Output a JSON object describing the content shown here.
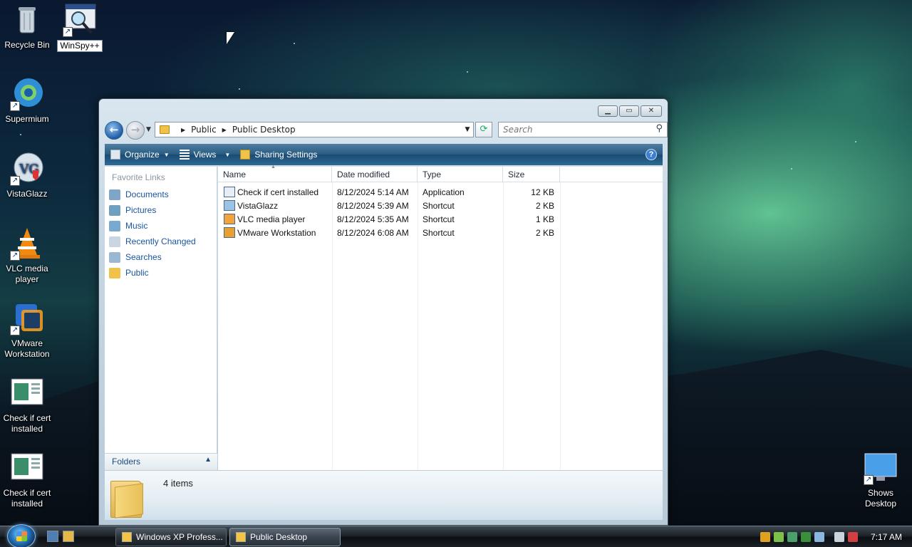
{
  "desktop": {
    "icons": [
      {
        "label": "Recycle Bin",
        "icon": "recycle-bin-icon"
      },
      {
        "label": "WinSpy++",
        "icon": "winspy-icon"
      },
      {
        "label": "Supermium",
        "icon": "supermium-icon"
      },
      {
        "label": "VistaGlazz",
        "icon": "vistaglazz-icon"
      },
      {
        "label": "VLC media player",
        "icon": "vlc-cone-icon"
      },
      {
        "label": "VMware Workstation",
        "icon": "vmware-icon"
      },
      {
        "label": "Check if cert installed",
        "icon": "app-window-icon"
      },
      {
        "label": "Check if cert installed",
        "icon": "app-window-icon"
      },
      {
        "label": "Shows Desktop",
        "icon": "show-desktop-icon"
      }
    ]
  },
  "window": {
    "address": {
      "segments": [
        "Public",
        "Public Desktop"
      ]
    },
    "search": {
      "placeholder": "Search"
    },
    "toolbar": {
      "organize": "Organize",
      "views": "Views",
      "sharing": "Sharing Settings"
    },
    "navpane": {
      "heading": "Favorite Links",
      "links": [
        "Documents",
        "Pictures",
        "Music",
        "Recently Changed",
        "Searches",
        "Public"
      ],
      "folders": "Folders"
    },
    "columns": {
      "name": "Name",
      "date": "Date modified",
      "type": "Type",
      "size": "Size"
    },
    "files": [
      {
        "name": "Check if cert installed",
        "date": "8/12/2024 5:14 AM",
        "type": "Application",
        "size": "12 KB"
      },
      {
        "name": "VistaGlazz",
        "date": "8/12/2024 5:39 AM",
        "type": "Shortcut",
        "size": "2 KB"
      },
      {
        "name": "VLC media player",
        "date": "8/12/2024 5:35 AM",
        "type": "Shortcut",
        "size": "1 KB"
      },
      {
        "name": "VMware Workstation",
        "date": "8/12/2024 6:08 AM",
        "type": "Shortcut",
        "size": "2 KB"
      }
    ],
    "details": {
      "count": "4 items"
    }
  },
  "taskbar": {
    "buttons": [
      "Windows XP Profess...",
      "Public Desktop"
    ],
    "clock": "7:17 AM"
  },
  "colors": {
    "accent": "#1a55a0",
    "toolbar": "#2a5d84"
  }
}
